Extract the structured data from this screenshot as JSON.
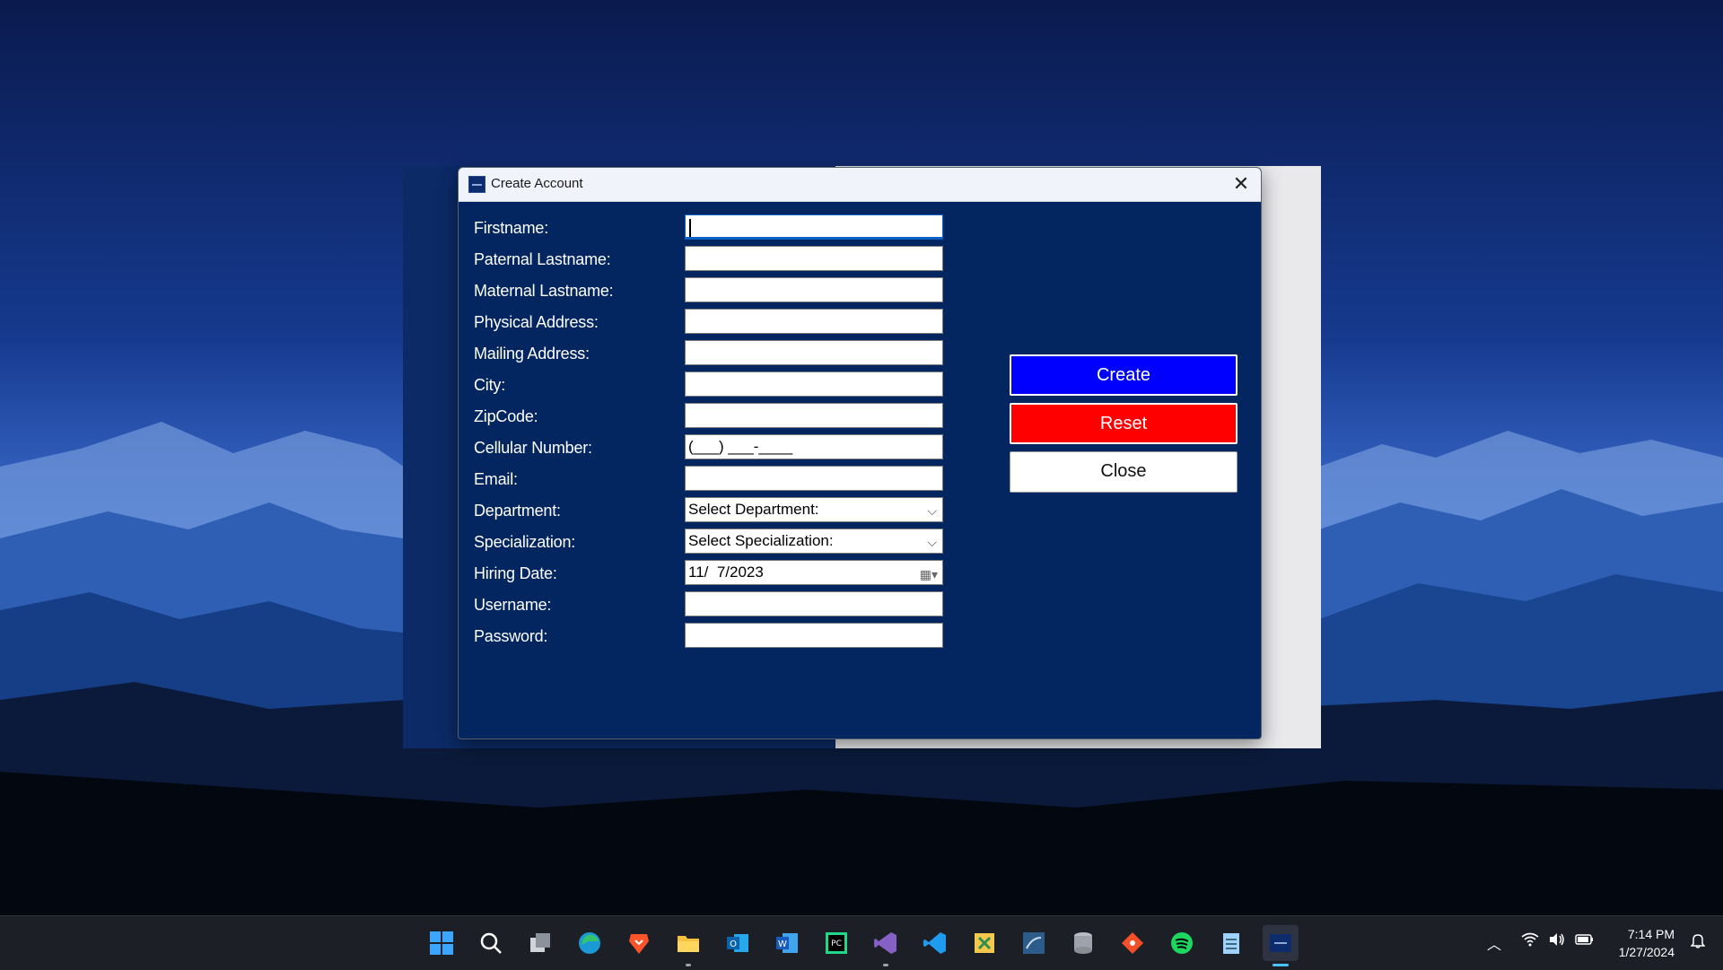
{
  "window": {
    "title": "Create Account"
  },
  "form": {
    "labels": {
      "firstname": "Firstname:",
      "paternal": "Paternal Lastname:",
      "maternal": "Maternal Lastname:",
      "physical": "Physical Address:",
      "mailing": "Mailing Address:",
      "city": "City:",
      "zipcode": "ZipCode:",
      "cellular": "Cellular Number:",
      "email": "Email:",
      "department": "Department:",
      "specialization": "Specialization:",
      "hiring": "Hiring Date:",
      "username": "Username:",
      "password": "Password:"
    },
    "values": {
      "firstname": "",
      "paternal": "",
      "maternal": "",
      "physical": "",
      "mailing": "",
      "city": "",
      "zipcode": "",
      "cellular": "(___) ___-____",
      "email": "",
      "department": "Select Department:",
      "specialization": "Select Specialization:",
      "hiring": "11/  7/2023",
      "username": "",
      "password": ""
    }
  },
  "buttons": {
    "create": "Create",
    "reset": "Reset",
    "close": "Close"
  },
  "colors": {
    "create": "#0000ff",
    "reset": "#ff0000",
    "dialog_bg": "#032660"
  },
  "taskbar": {
    "apps": [
      "windows-start-icon",
      "search-icon",
      "task-view-icon",
      "edge-icon",
      "brave-icon",
      "file-explorer-icon",
      "outlook-icon",
      "word-icon",
      "pycharm-icon",
      "visual-studio-icon",
      "vscode-icon",
      "snipping-tool-icon",
      "mysql-workbench-icon",
      "database-icon",
      "git-icon",
      "spotify-icon",
      "notepad-icon",
      "create-account-app-icon"
    ],
    "time": "7:14 PM",
    "date": "1/27/2024"
  }
}
